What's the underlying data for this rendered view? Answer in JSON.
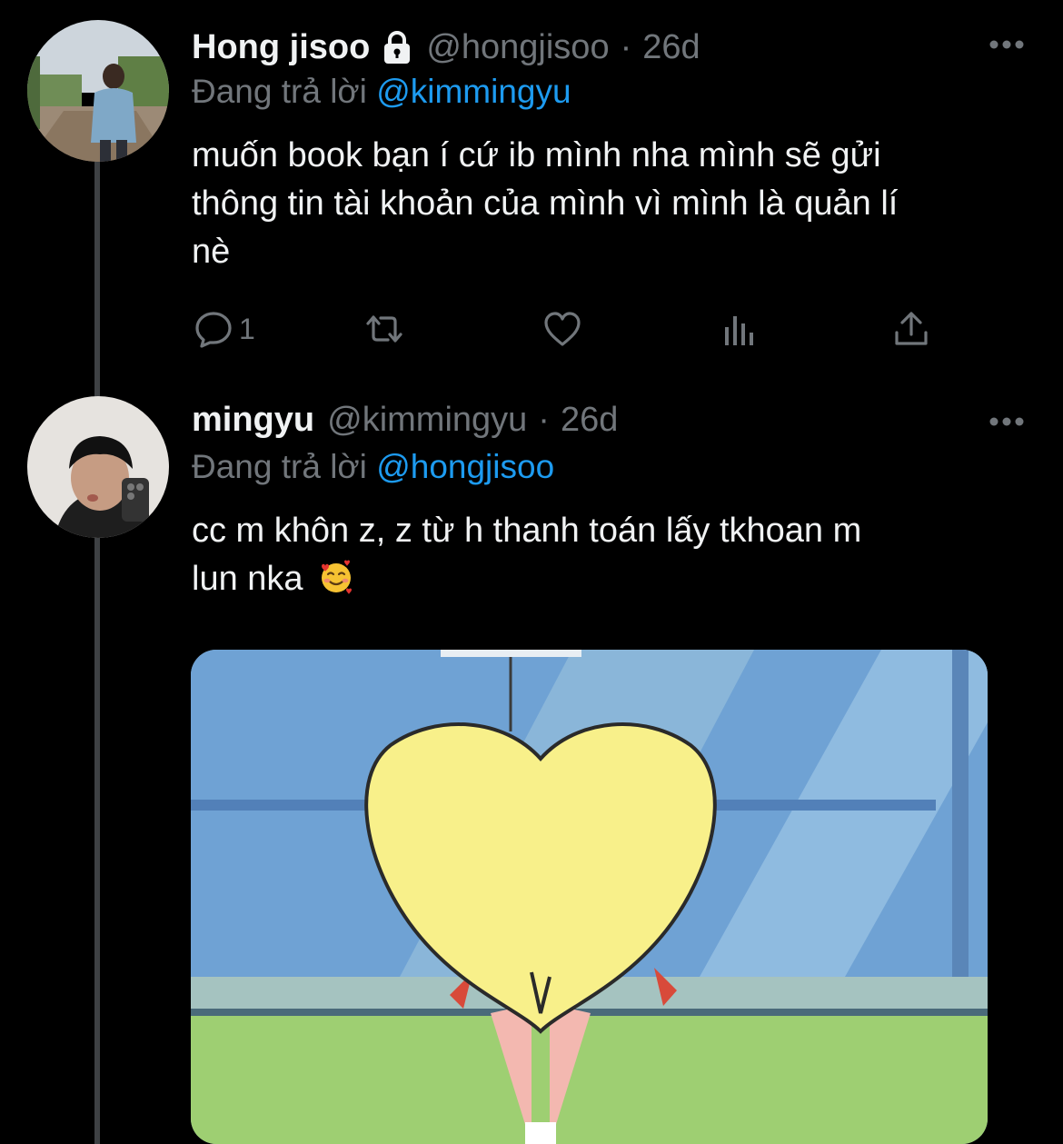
{
  "tweets": [
    {
      "display_name": "Hong jisoo",
      "handle": "@hongjisoo",
      "separator": "·",
      "time": "26d",
      "reply_prefix": "Đang trả lời",
      "reply_to": "@kimmingyu",
      "text_lines": [
        "muốn book bạn í cứ ib mình nha mình sẽ gửi",
        "thông tin tài khoản của mình vì mình là quản lí",
        "nè"
      ],
      "protected": true,
      "actions": {
        "reply_count": "1"
      },
      "icons": [
        "lock-icon",
        "more-icon",
        "reply-icon",
        "retweet-icon",
        "like-icon",
        "analytics-icon",
        "share-icon"
      ]
    },
    {
      "display_name": "mingyu",
      "handle": "@kimmingyu",
      "separator": "·",
      "time": "26d",
      "reply_prefix": "Đang trả lời",
      "reply_to": "@hongjisoo",
      "text_lines": [
        "cc m khôn z, z từ h thanh toán lấy tkhoan m",
        "lun nka"
      ],
      "emoji": "smiling-face-with-hearts-icon"
    }
  ],
  "colors": {
    "background": "#000000",
    "text": "#f0f2f3",
    "muted": "#71767b",
    "link": "#1d9bf0",
    "thread_line": "#3e4144"
  }
}
